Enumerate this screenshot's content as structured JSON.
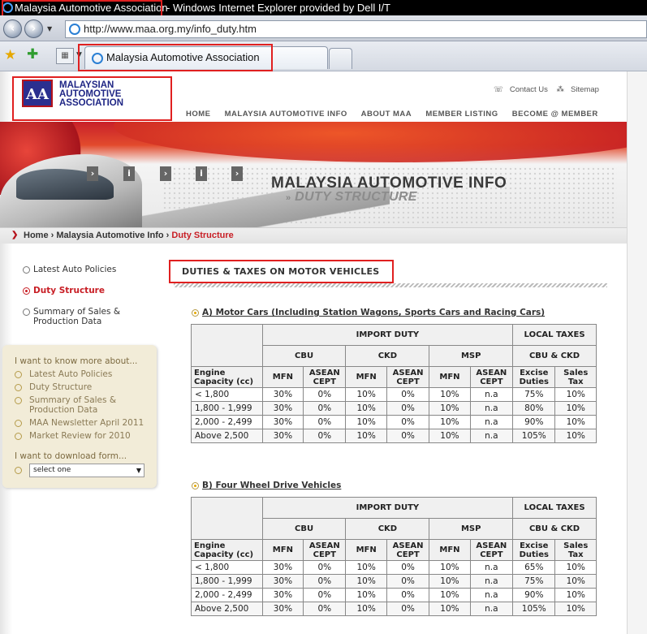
{
  "browser": {
    "window_title_site": "Malaysia Automotive Association",
    "window_title_rest": " - Windows Internet Explorer provided by Dell I/T",
    "url": "http://www.maa.org.my/info_duty.htm",
    "tab_label": "Malaysia Automotive Association"
  },
  "site": {
    "logo_mark": "AA",
    "logo_lines": [
      "MALAYSIAN",
      "AUTOMOTIVE",
      "ASSOCIATION"
    ],
    "top_links": {
      "contact": "Contact Us",
      "sitemap": "Sitemap"
    },
    "nav": [
      "HOME",
      "MALAYSIA AUTOMOTIVE INFO",
      "ABOUT MAA",
      "MEMBER LISTING",
      "BECOME @ MEMBER"
    ],
    "banner_title": "MALAYSIA AUTOMOTIVE INFO",
    "banner_subtitle": "DUTY STRUCTURE",
    "banner_arrows": "»",
    "breadcrumb": {
      "home": "Home",
      "section": "Malaysia Automotive Info",
      "current": "Duty Structure"
    }
  },
  "leftnav": {
    "items": [
      {
        "label": "Latest Auto Policies"
      },
      {
        "label": "Duty Structure"
      },
      {
        "label": "Summary of Sales &",
        "label2": "Production Data"
      }
    ]
  },
  "morebox": {
    "heading": "I want to know more about...",
    "items": [
      {
        "label": "Latest Auto Policies"
      },
      {
        "label": "Duty Structure"
      },
      {
        "label": "Summary of Sales &",
        "label2": "Production Data"
      },
      {
        "label": "MAA Newsletter April 2011"
      },
      {
        "label": "Market Review for 2010"
      }
    ],
    "download_heading": "I want to download form...",
    "select_value": "select one"
  },
  "main": {
    "section_title": "DUTIES & TAXES ON MOTOR VEHICLES",
    "headers": {
      "import_duty": "IMPORT DUTY",
      "local_taxes": "LOCAL TAXES",
      "cbu": "CBU",
      "ckd": "CKD",
      "msp": "MSP",
      "cbu_ckd": "CBU & CKD",
      "engine": "Engine",
      "capacity": "Capacity (cc)",
      "mfn": "MFN",
      "asean": "ASEAN",
      "cept": "CEPT",
      "excise": "Excise",
      "duties": "Duties",
      "sales": "Sales",
      "tax": "Tax"
    },
    "tables": [
      {
        "title": "A) Motor Cars (Including Station Wagons, Sports Cars and Racing Cars)",
        "rows": [
          [
            "< 1,800",
            "30%",
            "0%",
            "10%",
            "0%",
            "10%",
            "n.a",
            "75%",
            "10%"
          ],
          [
            "1,800 - 1,999",
            "30%",
            "0%",
            "10%",
            "0%",
            "10%",
            "n.a",
            "80%",
            "10%"
          ],
          [
            "2,000 - 2,499",
            "30%",
            "0%",
            "10%",
            "0%",
            "10%",
            "n.a",
            "90%",
            "10%"
          ],
          [
            "Above 2,500",
            "30%",
            "0%",
            "10%",
            "0%",
            "10%",
            "n.a",
            "105%",
            "10%"
          ]
        ]
      },
      {
        "title": "B) Four Wheel Drive Vehicles",
        "rows": [
          [
            "< 1,800",
            "30%",
            "0%",
            "10%",
            "0%",
            "10%",
            "n.a",
            "65%",
            "10%"
          ],
          [
            "1,800 - 1,999",
            "30%",
            "0%",
            "10%",
            "0%",
            "10%",
            "n.a",
            "75%",
            "10%"
          ],
          [
            "2,000 - 2,499",
            "30%",
            "0%",
            "10%",
            "0%",
            "10%",
            "n.a",
            "90%",
            "10%"
          ],
          [
            "Above 2,500",
            "30%",
            "0%",
            "10%",
            "0%",
            "10%",
            "n.a",
            "105%",
            "10%"
          ]
        ]
      }
    ]
  }
}
